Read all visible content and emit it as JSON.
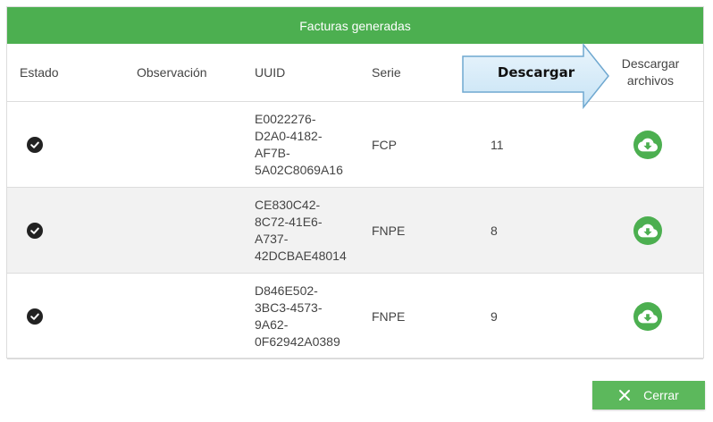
{
  "dialog": {
    "title": "Facturas generadas",
    "headers": {
      "estado": "Estado",
      "observacion": "Observación",
      "uuid": "UUID",
      "serie": "Serie",
      "descargar_archivos": "Descargar\narchivos"
    },
    "callout_label": "Descargar",
    "rows": [
      {
        "status_icon": "check-circle-icon",
        "observacion": "",
        "uuid": "E0022276-\nD2A0-4182-\nAF7B-\n5A02C8069A16",
        "serie": "FCP",
        "folio": "11",
        "download_icon": "cloud-download-icon"
      },
      {
        "status_icon": "check-circle-icon",
        "observacion": "",
        "uuid": "CE830C42-\n8C72-41E6-\nA737-\n42DCBAE48014",
        "serie": "FNPE",
        "folio": "8",
        "download_icon": "cloud-download-icon"
      },
      {
        "status_icon": "check-circle-icon",
        "observacion": "",
        "uuid": "D846E502-\n3BC3-4573-\n9A62-\n0F62942A0389",
        "serie": "FNPE",
        "folio": "9",
        "download_icon": "cloud-download-icon"
      }
    ],
    "close_label": "Cerrar"
  },
  "colors": {
    "header_green": "#4caf50",
    "button_green": "#5cb85c",
    "callout_fill": "#d6ecf8",
    "callout_border": "#6fa8d0"
  }
}
